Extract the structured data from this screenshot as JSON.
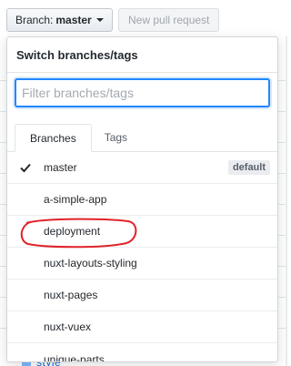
{
  "toolbar": {
    "branch_prefix": "Branch:",
    "branch_name": "master",
    "new_pull_request_label": "New pull request"
  },
  "dropdown": {
    "header_title": "Switch branches/tags",
    "filter": {
      "value": "",
      "placeholder": "Filter branches/tags"
    },
    "tabs": [
      {
        "label": "Branches",
        "selected": true
      },
      {
        "label": "Tags",
        "selected": false
      }
    ],
    "branches": [
      {
        "name": "master",
        "checked": true,
        "badge": "default"
      },
      {
        "name": "a-simple-app",
        "checked": false
      },
      {
        "name": "deployment",
        "checked": false,
        "annotated": true
      },
      {
        "name": "nuxt-layouts-styling",
        "checked": false
      },
      {
        "name": "nuxt-pages",
        "checked": false
      },
      {
        "name": "nuxt-vuex",
        "checked": false
      },
      {
        "name": "unique-parts",
        "checked": false
      }
    ]
  },
  "background": {
    "footer_partial_text": "style"
  },
  "colors": {
    "focus_blue": "#2188ff",
    "annotation_red": "#e0232a",
    "link_blue": "#0366d6"
  }
}
